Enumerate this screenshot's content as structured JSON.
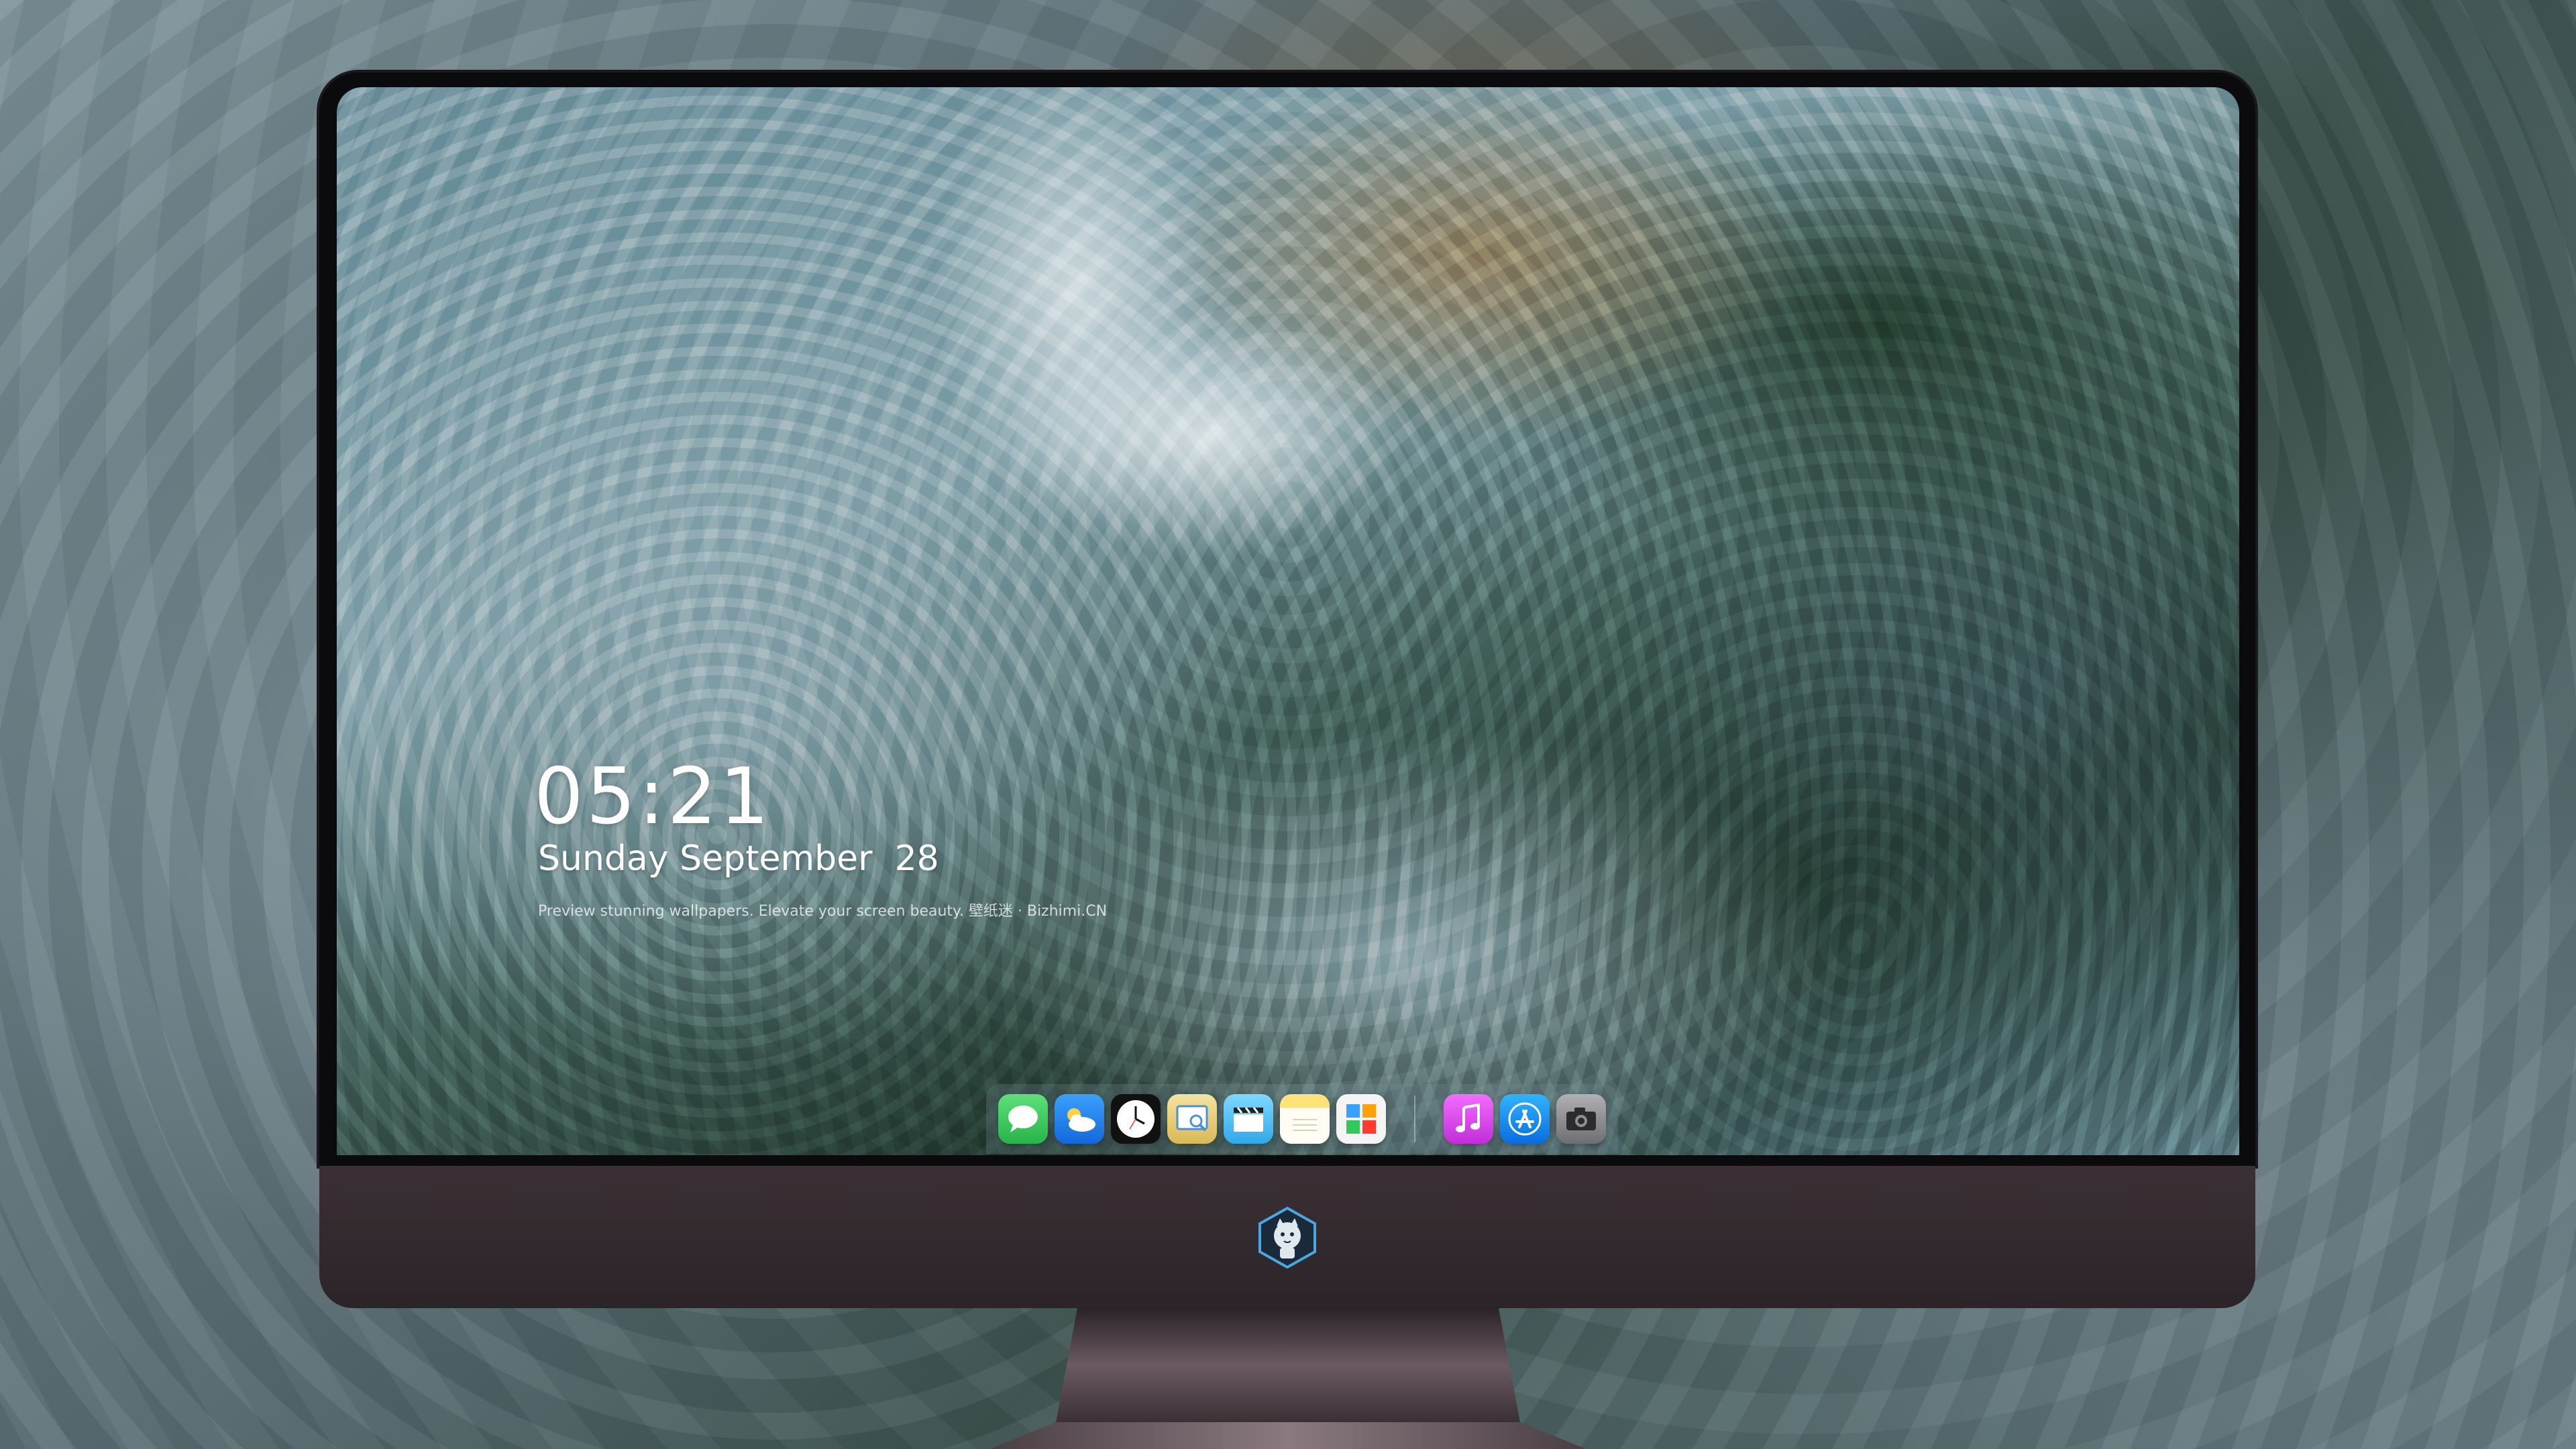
{
  "lockscreen": {
    "time": "05:21",
    "date": "Sunday September  28",
    "tagline": "Preview stunning wallpapers. Elevate your screen beauty. 壁纸迷 · Bizhimi.CN"
  },
  "dock": {
    "apps": [
      {
        "name": "Messages",
        "icon": "message-bubble-icon",
        "color": "#34c759"
      },
      {
        "name": "Weather",
        "icon": "cloud-sun-icon",
        "color": "#1e8ef0"
      },
      {
        "name": "Clock",
        "icon": "clock-icon",
        "color": "#111111"
      },
      {
        "name": "Preview",
        "icon": "preview-icon",
        "color": "#e9c46a"
      },
      {
        "name": "Clips",
        "icon": "clapperboard-icon",
        "color": "#5ac8fa"
      },
      {
        "name": "Notes",
        "icon": "notes-icon",
        "color": "#ffd60a"
      },
      {
        "name": "Calendar",
        "icon": "calendar-grid-icon",
        "color": "#f2f2f2"
      },
      {
        "name": "iTunes",
        "icon": "music-note-icon",
        "color": "#e040fb"
      },
      {
        "name": "App Store",
        "icon": "app-store-icon",
        "color": "#0a84ff"
      },
      {
        "name": "Camera",
        "icon": "camera-icon",
        "color": "#8e8e93"
      }
    ]
  },
  "chin": {
    "logo_icon": "mascot-logo-icon"
  }
}
